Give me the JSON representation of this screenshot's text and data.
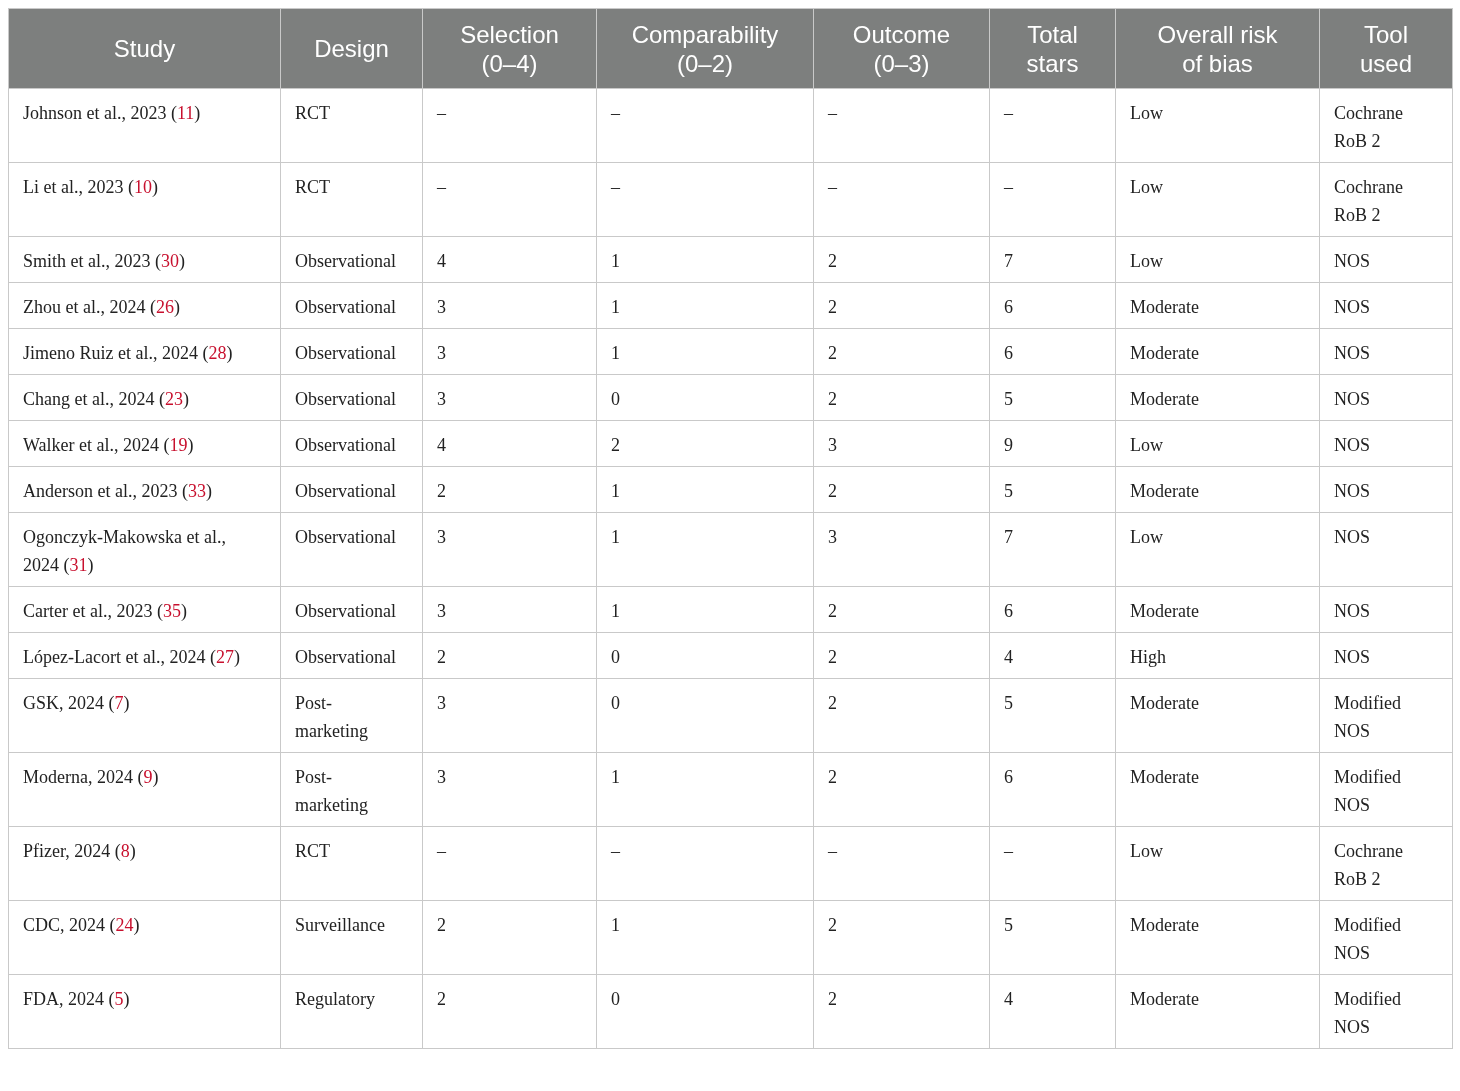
{
  "table": {
    "columns": [
      {
        "lines": [
          "Study"
        ]
      },
      {
        "lines": [
          "Design"
        ]
      },
      {
        "lines": [
          "Selection",
          "(0–4)"
        ]
      },
      {
        "lines": [
          "Comparability",
          "(0–2)"
        ]
      },
      {
        "lines": [
          "Outcome",
          "(0–3)"
        ]
      },
      {
        "lines": [
          "Total",
          "stars"
        ]
      },
      {
        "lines": [
          "Overall risk",
          "of bias"
        ]
      },
      {
        "lines": [
          "Tool",
          "used"
        ]
      }
    ],
    "rows": [
      {
        "cells": [
          {
            "before": "Johnson et al., 2023 (",
            "ref": "11",
            "after": ")"
          },
          "RCT",
          "–",
          "–",
          "–",
          "–",
          "Low",
          "Cochrane RoB 2"
        ]
      },
      {
        "cells": [
          {
            "before": "Li et al., 2023 (",
            "ref": "10",
            "after": ")"
          },
          "RCT",
          "–",
          "–",
          "–",
          "–",
          "Low",
          "Cochrane RoB 2"
        ]
      },
      {
        "cells": [
          {
            "before": "Smith et al., 2023 (",
            "ref": "30",
            "after": ")"
          },
          "Observational",
          "4",
          "1",
          "2",
          "7",
          "Low",
          "NOS"
        ]
      },
      {
        "cells": [
          {
            "before": "Zhou et al., 2024 (",
            "ref": "26",
            "after": ")"
          },
          "Observational",
          "3",
          "1",
          "2",
          "6",
          "Moderate",
          "NOS"
        ]
      },
      {
        "cells": [
          {
            "before": "Jimeno Ruiz et al., 2024 (",
            "ref": "28",
            "after": ")"
          },
          "Observational",
          "3",
          "1",
          "2",
          "6",
          "Moderate",
          "NOS"
        ]
      },
      {
        "cells": [
          {
            "before": "Chang et al., 2024 (",
            "ref": "23",
            "after": ")"
          },
          "Observational",
          "3",
          "0",
          "2",
          "5",
          "Moderate",
          "NOS"
        ]
      },
      {
        "cells": [
          {
            "before": "Walker et al., 2024 (",
            "ref": "19",
            "after": ")"
          },
          "Observational",
          "4",
          "2",
          "3",
          "9",
          "Low",
          "NOS"
        ]
      },
      {
        "cells": [
          {
            "before": "Anderson et al., 2023 (",
            "ref": "33",
            "after": ")"
          },
          "Observational",
          "2",
          "1",
          "2",
          "5",
          "Moderate",
          "NOS"
        ]
      },
      {
        "cells": [
          {
            "before": "Ogonczyk-Makowska et al., 2024 (",
            "ref": "31",
            "after": ")"
          },
          "Observational",
          "3",
          "1",
          "3",
          "7",
          "Low",
          "NOS"
        ]
      },
      {
        "cells": [
          {
            "before": "Carter et al., 2023 (",
            "ref": "35",
            "after": ")"
          },
          "Observational",
          "3",
          "1",
          "2",
          "6",
          "Moderate",
          "NOS"
        ]
      },
      {
        "cells": [
          {
            "before": "López-Lacort et al., 2024 (",
            "ref": "27",
            "after": ")"
          },
          "Observational",
          "2",
          "0",
          "2",
          "4",
          "High",
          "NOS"
        ]
      },
      {
        "cells": [
          {
            "before": "GSK, 2024 (",
            "ref": "7",
            "after": ")"
          },
          "Post-marketing",
          "3",
          "0",
          "2",
          "5",
          "Moderate",
          "Modified NOS"
        ]
      },
      {
        "cells": [
          {
            "before": "Moderna, 2024 (",
            "ref": "9",
            "after": ")"
          },
          "Post-marketing",
          "3",
          "1",
          "2",
          "6",
          "Moderate",
          "Modified NOS"
        ]
      },
      {
        "cells": [
          {
            "before": "Pfizer, 2024 (",
            "ref": "8",
            "after": ")"
          },
          "RCT",
          "–",
          "–",
          "–",
          "–",
          "Low",
          "Cochrane RoB 2"
        ]
      },
      {
        "cells": [
          {
            "before": "CDC, 2024 (",
            "ref": "24",
            "after": ")"
          },
          "Surveillance",
          "2",
          "1",
          "2",
          "5",
          "Moderate",
          "Modified NOS"
        ]
      },
      {
        "cells": [
          {
            "before": "FDA, 2024 (",
            "ref": "5",
            "after": ")"
          },
          "Regulatory",
          "2",
          "0",
          "2",
          "4",
          "Moderate",
          "Modified NOS"
        ]
      }
    ]
  }
}
